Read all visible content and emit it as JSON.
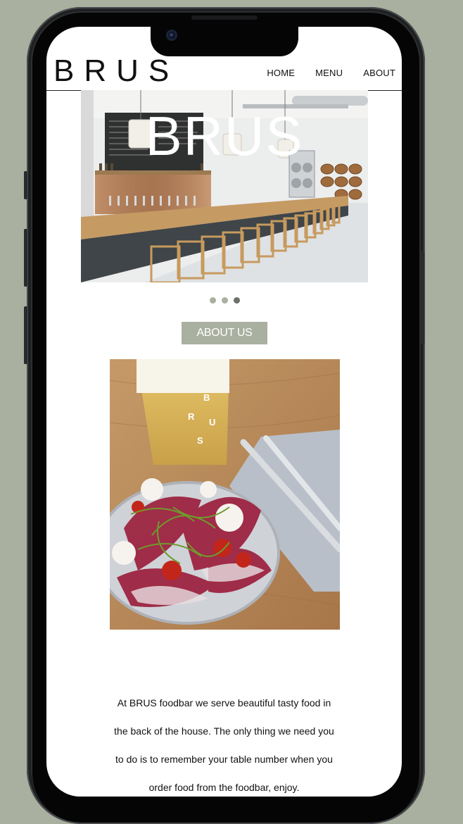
{
  "site": {
    "logo": "BRUS"
  },
  "nav": {
    "items": [
      "HOME",
      "MENU",
      "ABOUT"
    ]
  },
  "hero": {
    "title": "BRUS"
  },
  "carousel": {
    "count": 3,
    "active_index": 2
  },
  "about": {
    "button_label": "ABOUT US",
    "lines": [
      "At BRUS foodbar we serve beautiful tasty food in",
      "the back of the house. The only thing we need you",
      "to do is to remember your table number when you",
      "order food from the foodbar, enjoy."
    ]
  },
  "glass_letters": [
    "B",
    "R",
    "U",
    "S"
  ],
  "colors": {
    "accent": "#aab09f",
    "dot_active": "#6c6f6a",
    "background": "#aab09f"
  }
}
